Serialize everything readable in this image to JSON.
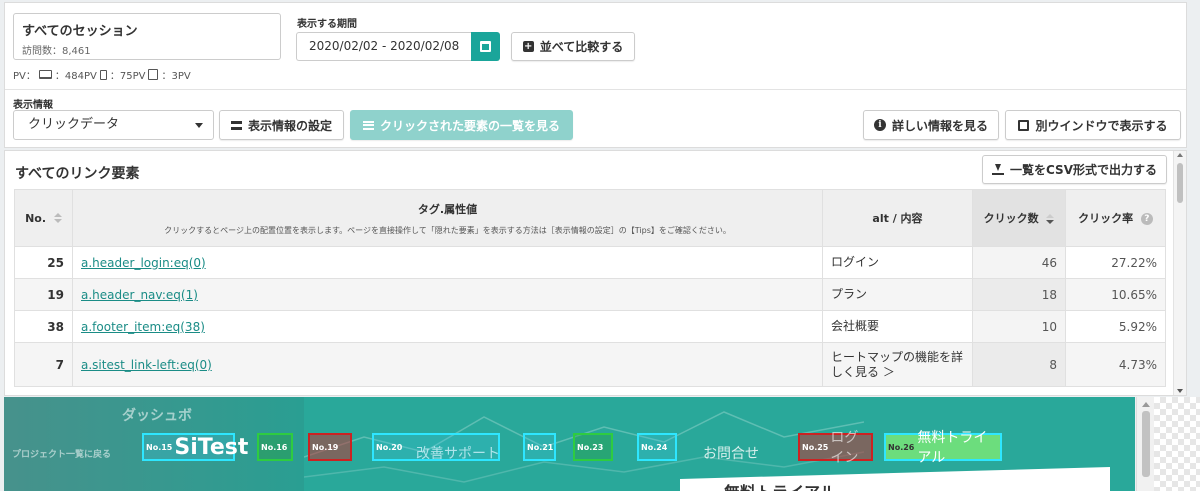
{
  "session": {
    "title": "すべてのセッション",
    "visits": "訪問数：8,461",
    "pv_label": "PV：",
    "pv_pc": "：484PV",
    "pv_sp": "：75PV",
    "pv_tab": "：3PV"
  },
  "period": {
    "label": "表示する期間",
    "value": "2020/02/02 - 2020/02/08",
    "compare_button": "並べて比較する"
  },
  "display": {
    "label": "表示情報",
    "selected": "クリックデータ",
    "settings_button": "表示情報の設定",
    "elements_button": "クリックされた要素の一覧を見る",
    "detail_button": "詳しい情報を見る",
    "new_window_button": "別ウインドウで表示する"
  },
  "table": {
    "title": "すべてのリンク要素",
    "csv_button": "一覧をCSV形式で出力する",
    "headers": {
      "no": "No.",
      "tag": "タグ.属性値",
      "tag_note": "クリックするとページ上の配置位置を表示します。ページを直接操作して「隠れた要素」を表示する方法は［表示情報の設定］の【Tips】をご確認ください。",
      "alt": "alt / 内容",
      "clicks": "クリック数",
      "rate": "クリック率"
    },
    "rows": [
      {
        "no": "25",
        "tag": "a.header_login:eq(0)",
        "alt": "ログイン",
        "clicks": "46",
        "rate": "27.22%"
      },
      {
        "no": "19",
        "tag": "a.header_nav:eq(1)",
        "alt": "プラン",
        "clicks": "18",
        "rate": "10.65%"
      },
      {
        "no": "38",
        "tag": "a.footer_item:eq(38)",
        "alt": "会社概要",
        "clicks": "10",
        "rate": "5.92%"
      },
      {
        "no": "7",
        "tag": "a.sitest_link-left:eq(0)",
        "alt": "ヒートマップの機能を詳しく見る ＞",
        "clicks": "8",
        "rate": "4.73%"
      }
    ]
  },
  "preview": {
    "bg_dashboard": "ダッシュボ",
    "bg_project": "プロジェクト一覧に戻る",
    "nav_improve": "改善サポート",
    "nav_contact": "お問合せ",
    "nav_trial": "無料トライアル",
    "nav_login": "ログイン",
    "card_title": "無料トライアル",
    "markers": [
      {
        "no": "No.15",
        "label": "SiTest"
      },
      {
        "no": "No.16",
        "label": ""
      },
      {
        "no": "No.19",
        "label": ""
      },
      {
        "no": "No.20",
        "label": ""
      },
      {
        "no": "No.21",
        "label": ""
      },
      {
        "no": "No.23",
        "label": ""
      },
      {
        "no": "No.24",
        "label": ""
      },
      {
        "no": "No.25",
        "label": ""
      },
      {
        "no": "No.26",
        "label": ""
      }
    ]
  },
  "colors": {
    "accent": "#1aa59a",
    "link": "#1a8c86",
    "preview_bg": "#29a89a"
  }
}
